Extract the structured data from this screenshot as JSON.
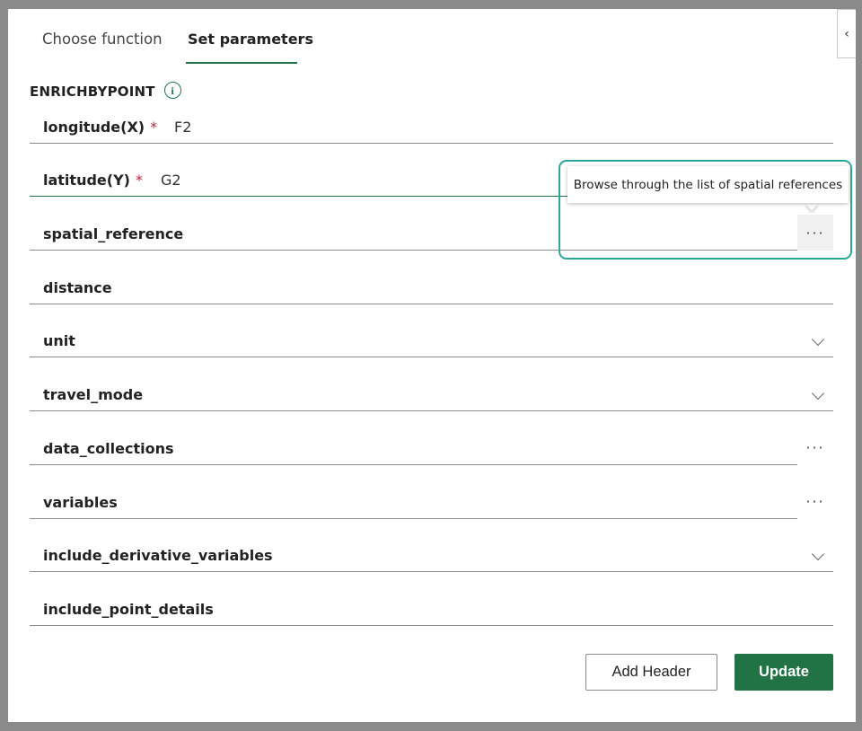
{
  "tabs": [
    {
      "label": "Choose function"
    },
    {
      "label": "Set parameters"
    }
  ],
  "function_name": "ENRICHBYPOINT",
  "collapse_glyph": "‹",
  "info_glyph": "i",
  "required_mark": "*",
  "more_glyph": "···",
  "fields": {
    "longitude": {
      "label": "longitude(X)",
      "value": "F2"
    },
    "latitude": {
      "label": "latitude(Y)",
      "value": "G2"
    },
    "spatial_reference": {
      "label": "spatial_reference",
      "value": ""
    },
    "distance": {
      "label": "distance",
      "value": ""
    },
    "unit": {
      "label": "unit",
      "value": ""
    },
    "travel_mode": {
      "label": "travel_mode",
      "value": ""
    },
    "data_collections": {
      "label": "data_collections",
      "value": ""
    },
    "variables": {
      "label": "variables",
      "value": ""
    },
    "include_derivative_variables": {
      "label": "include_derivative_variables",
      "value": ""
    },
    "include_point_details": {
      "label": "include_point_details",
      "value": ""
    }
  },
  "tooltip": "Browse through the list of spatial references",
  "buttons": {
    "add_header": "Add Header",
    "update": "Update"
  },
  "colors": {
    "accent": "#217346",
    "highlight": "#2ba89a",
    "required": "#b4263e"
  }
}
